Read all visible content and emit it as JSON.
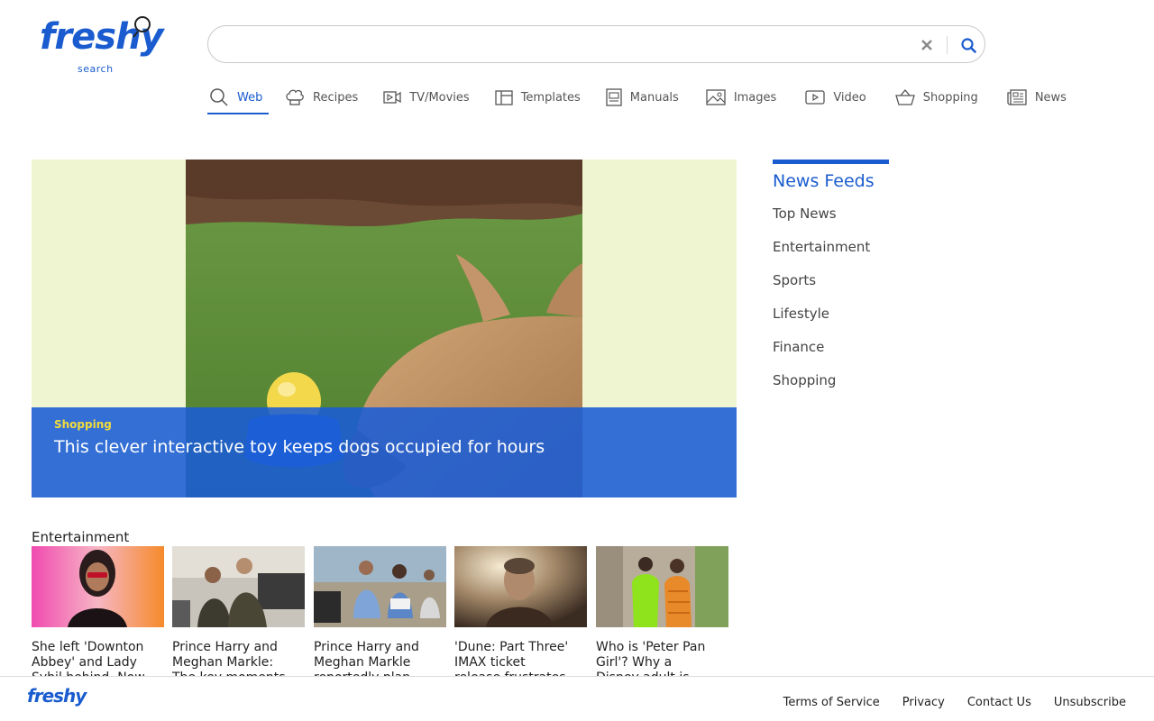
{
  "brand": {
    "name": "freshy",
    "tagline": "search",
    "color": "#1a5ccf"
  },
  "search": {
    "value": "",
    "placeholder": ""
  },
  "tabs": [
    {
      "label": "Web",
      "icon": "search-icon",
      "active": true
    },
    {
      "label": "Recipes",
      "icon": "chef-hat-icon"
    },
    {
      "label": "TV/Movies",
      "icon": "video-camera-icon"
    },
    {
      "label": "Templates",
      "icon": "layout-icon"
    },
    {
      "label": "Manuals",
      "icon": "book-icon"
    },
    {
      "label": "Images",
      "icon": "image-icon"
    },
    {
      "label": "Video",
      "icon": "play-icon"
    },
    {
      "label": "Shopping",
      "icon": "basket-icon"
    },
    {
      "label": "News",
      "icon": "newspaper-icon"
    }
  ],
  "hero": {
    "category": "Shopping",
    "title": "This clever interactive toy keeps dogs occupied for hours"
  },
  "feeds": {
    "title": "News Feeds",
    "items": [
      "Top News",
      "Entertainment",
      "Sports",
      "Lifestyle",
      "Finance",
      "Shopping"
    ]
  },
  "entertainment": {
    "title": "Entertainment",
    "cards": [
      {
        "line1": "She left 'Downton",
        "line2": "Abbey' and Lady",
        "line3": "Sybil behind. Now"
      },
      {
        "line1": "Prince Harry and",
        "line2": "Meghan Markle:",
        "line3": "The key moments"
      },
      {
        "line1": "Prince Harry and",
        "line2": "Meghan Markle",
        "line3": "reportedly plan"
      },
      {
        "line1": "'Dune: Part Three'",
        "line2": "IMAX ticket",
        "line3": "release frustrates"
      },
      {
        "line1": "Who is 'Peter Pan",
        "line2": "Girl'? Why a",
        "line3": "Disney adult is"
      }
    ]
  },
  "footer": {
    "links": [
      "Terms of Service",
      "Privacy",
      "Contact Us",
      "Unsubscribe"
    ]
  }
}
